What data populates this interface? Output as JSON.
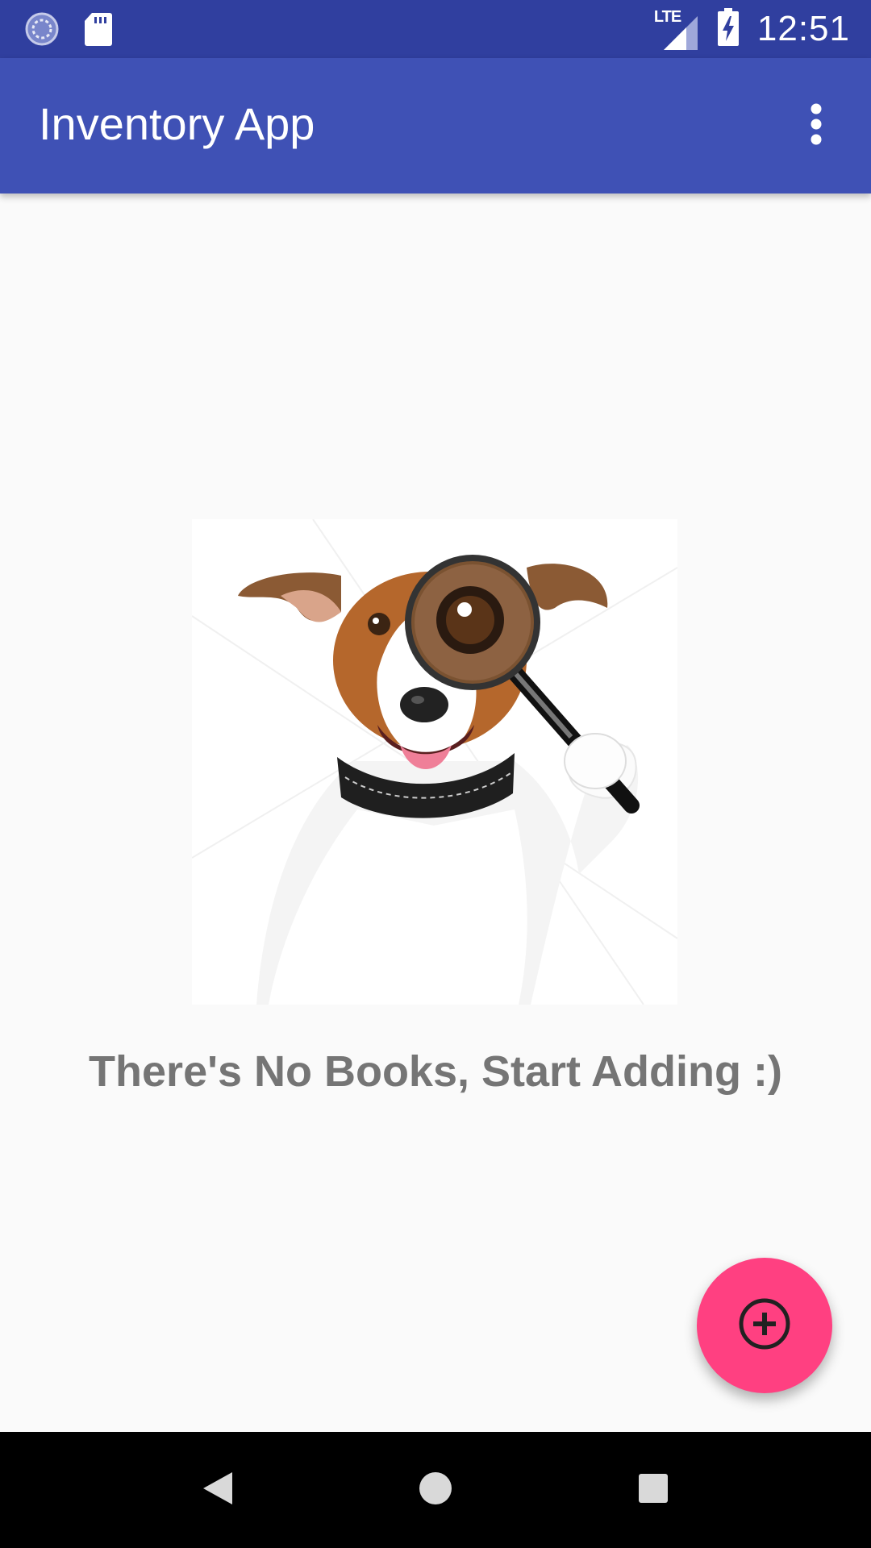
{
  "status_bar": {
    "time": "12:51",
    "network_label": "LTE",
    "icons": [
      "sync-icon",
      "sd-card-icon",
      "signal-icon",
      "battery-charging-icon"
    ],
    "background": "#303f9f"
  },
  "app_bar": {
    "title": "Inventory App",
    "overflow_icon": "more-vert-icon",
    "background": "#3f51b5"
  },
  "empty_state": {
    "image": "dog-with-magnifying-glass",
    "message": "There's No Books, Start Adding :)",
    "text_color": "#757575"
  },
  "fab": {
    "icon": "add-circle-icon",
    "color": "#ff4081"
  },
  "nav_bar": {
    "buttons": [
      "back-icon",
      "home-icon",
      "recents-icon"
    ]
  }
}
